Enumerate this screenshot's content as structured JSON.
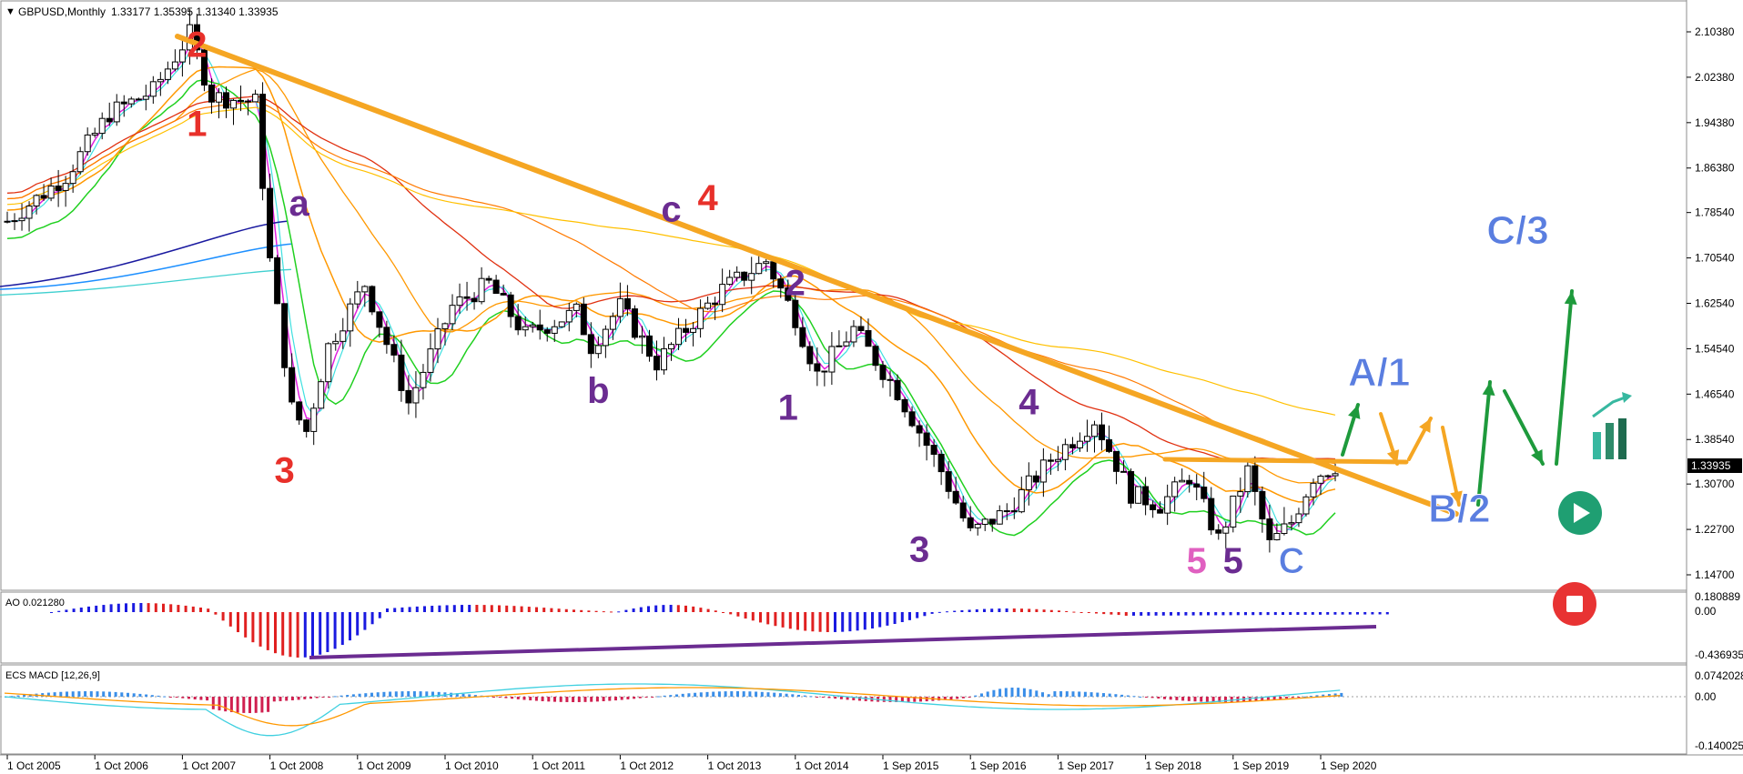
{
  "header": {
    "symbol": "GBPUSD,Monthly",
    "ohlc": "1.33177 1.35395 1.31340 1.33935"
  },
  "chart_data": {
    "type": "candlestick",
    "price_axis": {
      "ticks": [
        "2.10380",
        "2.02380",
        "1.94380",
        "1.86380",
        "1.78540",
        "1.70540",
        "1.62540",
        "1.54540",
        "1.46540",
        "1.38540",
        "1.30700",
        "1.22700",
        "1.14700"
      ],
      "range": [
        1.1185,
        2.154
      ]
    },
    "current_price": "1.33935",
    "date_axis": [
      "1 Oct 2005",
      "1 Oct 2006",
      "1 Oct 2007",
      "1 Oct 2008",
      "1 Oct 2009",
      "1 Oct 2010",
      "1 Oct 2011",
      "1 Oct 2012",
      "1 Oct 2013",
      "1 Oct 2014",
      "1 Sep 2015",
      "1 Sep 2016",
      "1 Sep 2017",
      "1 Sep 2018",
      "1 Sep 2019",
      "1 Sep 2020"
    ],
    "close_path": [
      [
        "2005-10",
        1.77
      ],
      [
        "2006-06",
        1.85
      ],
      [
        "2006-12",
        1.96
      ],
      [
        "2007-06",
        2.0
      ],
      [
        "2007-11",
        2.1
      ],
      [
        "2008-02",
        1.99
      ],
      [
        "2008-08",
        1.98
      ],
      [
        "2008-10",
        1.7
      ],
      [
        "2009-01",
        1.44
      ],
      [
        "2009-03",
        1.4
      ],
      [
        "2009-06",
        1.55
      ],
      [
        "2009-11",
        1.66
      ],
      [
        "2010-05",
        1.45
      ],
      [
        "2010-11",
        1.62
      ],
      [
        "2011-04",
        1.66
      ],
      [
        "2011-09",
        1.57
      ],
      [
        "2012-04",
        1.61
      ],
      [
        "2012-06",
        1.55
      ],
      [
        "2012-10",
        1.62
      ],
      [
        "2013-03",
        1.52
      ],
      [
        "2013-07",
        1.58
      ],
      [
        "2013-12",
        1.65
      ],
      [
        "2014-06",
        1.7
      ],
      [
        "2014-10",
        1.6
      ],
      [
        "2015-01",
        1.5
      ],
      [
        "2015-06",
        1.58
      ],
      [
        "2015-12",
        1.47
      ],
      [
        "2016-06",
        1.33
      ],
      [
        "2016-10",
        1.22
      ],
      [
        "2017-03",
        1.26
      ],
      [
        "2017-09",
        1.35
      ],
      [
        "2018-03",
        1.42
      ],
      [
        "2018-08",
        1.29
      ],
      [
        "2018-12",
        1.27
      ],
      [
        "2019-04",
        1.32
      ],
      [
        "2019-08",
        1.21
      ],
      [
        "2019-12",
        1.33
      ],
      [
        "2020-03",
        1.2
      ],
      [
        "2020-06",
        1.24
      ],
      [
        "2020-09",
        1.32
      ],
      [
        "2020-12",
        1.3394
      ]
    ],
    "wave_labels": [
      {
        "text": "2",
        "color": "#e8302a",
        "date": "2007-12",
        "price": 2.06
      },
      {
        "text": "1",
        "color": "#e8302a",
        "date": "2007-12",
        "price": 1.92
      },
      {
        "text": "3",
        "color": "#e8302a",
        "date": "2008-12",
        "price": 1.31
      },
      {
        "text": "a",
        "color": "#6b2c91",
        "date": "2009-02",
        "price": 1.78
      },
      {
        "text": "b",
        "color": "#6b2c91",
        "date": "2012-07",
        "price": 1.45
      },
      {
        "text": "c",
        "color": "#6b2c91",
        "date": "2013-05",
        "price": 1.77
      },
      {
        "text": "4",
        "color": "#e8302a",
        "date": "2013-10",
        "price": 1.79
      },
      {
        "text": "2",
        "color": "#6b2c91",
        "date": "2014-10",
        "price": 1.64
      },
      {
        "text": "1",
        "color": "#6b2c91",
        "date": "2014-09",
        "price": 1.42
      },
      {
        "text": "3",
        "color": "#6b2c91",
        "date": "2016-03",
        "price": 1.17
      },
      {
        "text": "4",
        "color": "#6b2c91",
        "date": "2017-06",
        "price": 1.43
      },
      {
        "text": "5",
        "color": "#e060c0",
        "date": "2019-05",
        "price": 1.15
      },
      {
        "text": "5",
        "color": "#6b2c91",
        "date": "2019-10",
        "price": 1.15
      },
      {
        "text": "C",
        "color": "#5a7ee0",
        "date": "2020-06",
        "price": 1.15
      },
      {
        "text": "A/1",
        "color": "#5a7ee0",
        "date": "2021-06",
        "price": 1.48
      },
      {
        "text": "B/2",
        "color": "#5a7ee0",
        "date": "2022-05",
        "price": 1.24
      },
      {
        "text": "C/3",
        "color": "#5a7ee0",
        "date": "2023-01",
        "price": 1.73
      }
    ],
    "ao": {
      "label": "AO 0.021280",
      "ticks": [
        "0.180889",
        "0.00",
        "-0.436935"
      ]
    },
    "macd": {
      "label": "ECS MACD [12,26,9]",
      "ticks": [
        "0.0742028",
        "0.00",
        "-0.1400255"
      ]
    }
  },
  "colors": {
    "trendline": "#f5a623",
    "bull_candle": "#ffffff",
    "bear_candle": "#000000",
    "ao_up": "#1a1ae0",
    "ao_down": "#e02020",
    "forecast_green": "#1e9a3c",
    "forecast_orange": "#f5a623",
    "wave_blue": "#5a7ee0"
  },
  "icons": [
    "play-icon",
    "stop-icon",
    "chart-bars-icon"
  ]
}
